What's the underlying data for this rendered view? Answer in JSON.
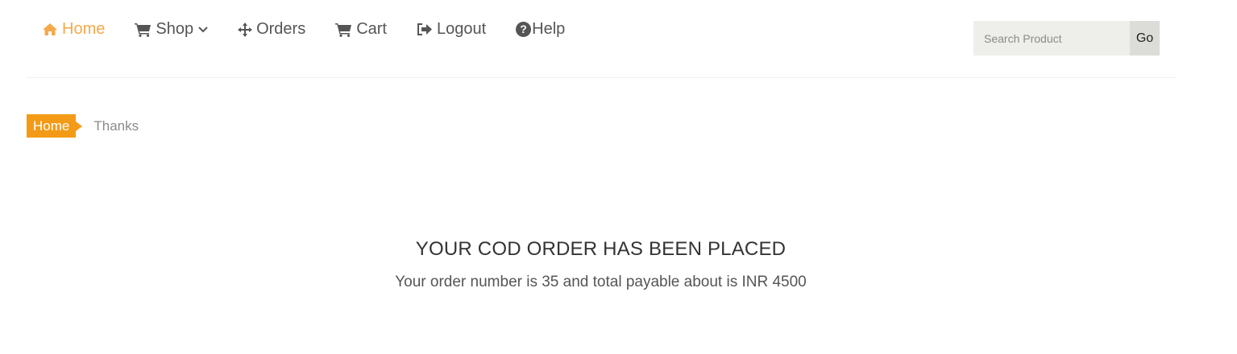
{
  "nav": {
    "items": [
      {
        "label": "Home",
        "icon": "home-icon",
        "active": true
      },
      {
        "label": "Shop",
        "icon": "cart-icon",
        "dropdown": true
      },
      {
        "label": "Orders",
        "icon": "crosshairs-icon"
      },
      {
        "label": "Cart",
        "icon": "cart-icon"
      },
      {
        "label": "Logout",
        "icon": "sign-out-icon"
      },
      {
        "label": "Help",
        "icon": "question-circle-icon"
      }
    ],
    "active_color": "#f5a94a",
    "text_color": "#555555"
  },
  "search": {
    "placeholder": "Search Product",
    "value": "",
    "button_label": "Go"
  },
  "breadcrumb": {
    "home": "Home",
    "current": "Thanks",
    "accent_color": "#f39b16"
  },
  "order": {
    "heading": "YOUR COD ORDER HAS BEEN PLACED",
    "message": "Your order number is 35 and total payable about is INR 4500"
  }
}
